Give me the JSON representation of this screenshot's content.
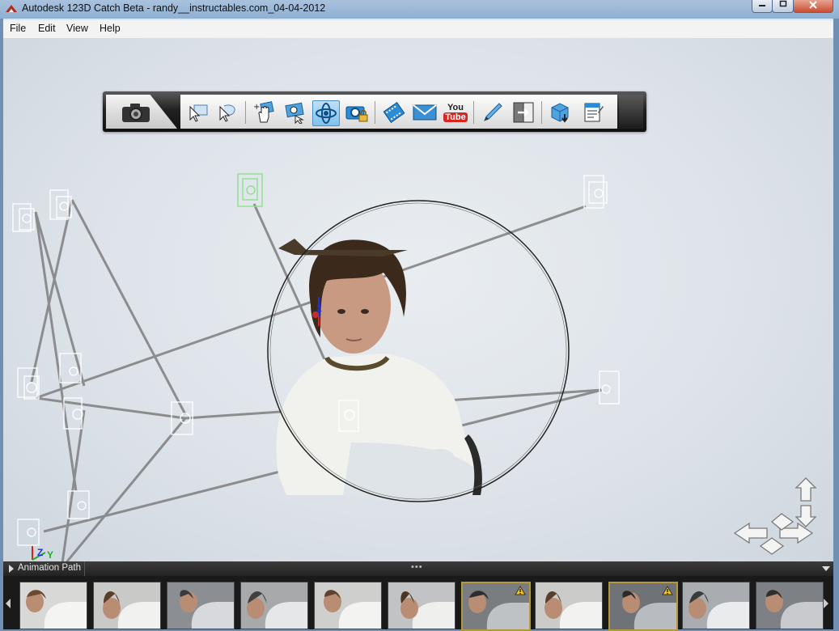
{
  "window": {
    "title": "Autodesk 123D Catch Beta - randy__instructables.com_04-04-2012",
    "minimize_icon": "minimize-icon",
    "maximize_icon": "maximize-icon",
    "close_icon": "close-icon"
  },
  "menu": {
    "items": [
      {
        "label": "File"
      },
      {
        "label": "Edit"
      },
      {
        "label": "View"
      },
      {
        "label": "Help"
      }
    ]
  },
  "toolbar": {
    "tools": [
      {
        "icon": "camera-icon"
      },
      {
        "icon": "select-arrow-icon"
      },
      {
        "icon": "lasso-select-icon"
      },
      {
        "icon": "pan-hand-icon"
      },
      {
        "icon": "zoom-window-icon"
      },
      {
        "icon": "orbit-icon",
        "active": true
      },
      {
        "icon": "camera-lock-icon"
      },
      {
        "icon": "film-strip-icon"
      },
      {
        "icon": "email-icon"
      },
      {
        "icon": "youtube-icon"
      },
      {
        "icon": "pen-icon"
      },
      {
        "icon": "export-icon"
      },
      {
        "icon": "mesh-download-icon"
      },
      {
        "icon": "properties-icon"
      }
    ],
    "youtube": {
      "you": "You",
      "tube": "Tube"
    }
  },
  "viewport": {
    "axis_labels": {
      "x": "X",
      "y": "Y",
      "z": "Z"
    },
    "axis_colors": {
      "x": "#e02020",
      "y": "#20b020",
      "z": "#2030e0"
    },
    "selected_camera_color": "#8ee08e",
    "camera_line_color": "#7e7e7e",
    "nav_icon": "view-navigation-arrows-icon"
  },
  "animation_panel": {
    "label": "Animation Path",
    "grip": "•••"
  },
  "filmstrip": {
    "frames": [
      {
        "warning": false
      },
      {
        "warning": false
      },
      {
        "warning": false
      },
      {
        "warning": false
      },
      {
        "warning": false
      },
      {
        "warning": false
      },
      {
        "warning": true
      },
      {
        "warning": false
      },
      {
        "warning": true
      },
      {
        "warning": false
      },
      {
        "warning": false
      }
    ],
    "warning_color": "#b3993a"
  }
}
